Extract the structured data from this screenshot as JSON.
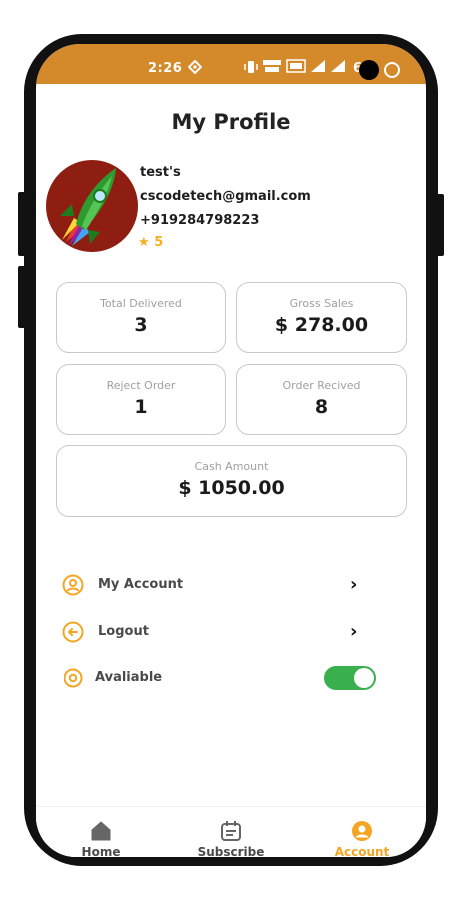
{
  "status_bar": {
    "time": "2:26",
    "battery": "6"
  },
  "header": {
    "title": "My Profile"
  },
  "profile": {
    "name": "test's",
    "email": "cscodetech@gmail.com",
    "phone": "+919284798223",
    "rating": "5"
  },
  "stats": {
    "total_delivered": {
      "label": "Total Delivered",
      "value": "3"
    },
    "gross_sales": {
      "label": "Gross Sales",
      "value": "$ 278.00"
    },
    "reject_order": {
      "label": "Reject Order",
      "value": "1"
    },
    "order_received": {
      "label": "Order Recived",
      "value": "8"
    },
    "cash_amount": {
      "label": "Cash Amount",
      "value": "$ 1050.00"
    }
  },
  "menu": {
    "my_account": {
      "label": "My Account"
    },
    "logout": {
      "label": "Logout"
    },
    "available": {
      "label": "Avaliable",
      "toggle_on": true
    }
  },
  "bottom_nav": {
    "home": {
      "label": "Home"
    },
    "subscribe": {
      "label": "Subscribe"
    },
    "account": {
      "label": "Account",
      "active": true
    }
  },
  "colors": {
    "accent": "#f4a524",
    "status_bar": "#d4892a",
    "toggle_on": "#3aaf4e"
  }
}
